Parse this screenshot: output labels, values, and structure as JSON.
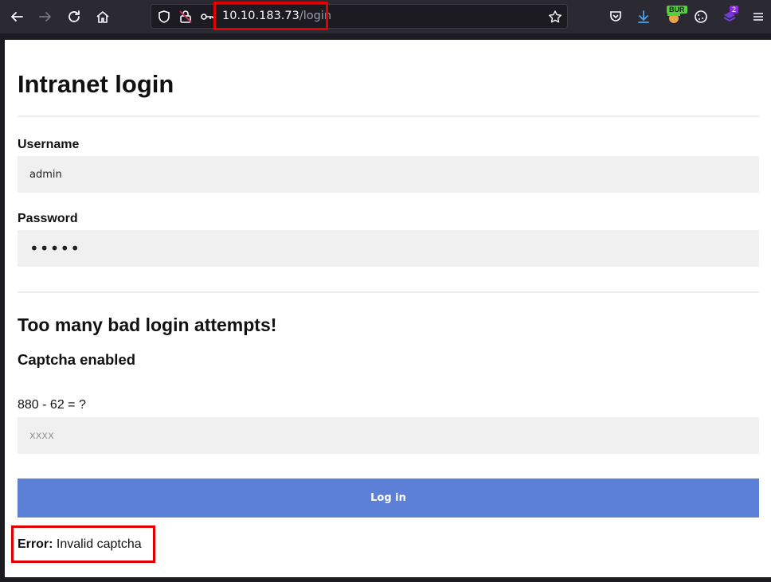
{
  "browser": {
    "url_host": "10.10.183.73",
    "url_path": "/login",
    "extension_badge": "2",
    "burp_label": "BUR"
  },
  "page": {
    "title": "Intranet login",
    "username_label": "Username",
    "username_value": "admin",
    "password_label": "Password",
    "password_value": "•••••",
    "warning_heading": "Too many bad login attempts!",
    "captcha_heading": "Captcha enabled",
    "captcha_question": "880 - 62 = ?",
    "captcha_placeholder": "xxxx",
    "login_button": "Log in",
    "error_label": "Error:",
    "error_message": "Invalid captcha"
  },
  "colors": {
    "accent_button": "#5b80d6",
    "highlight_red": "#e00000"
  }
}
